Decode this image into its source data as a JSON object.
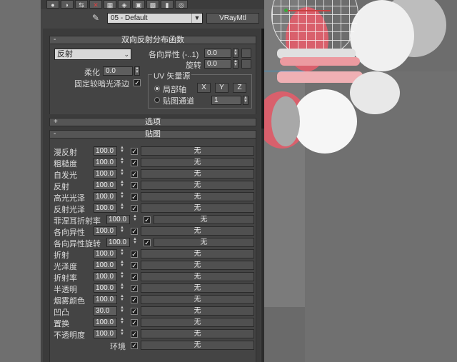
{
  "material": {
    "name": "05 - Default",
    "type": "VRayMtl"
  },
  "brdf": {
    "title": "双向反射分布函数",
    "type_value": "反射",
    "anisotropy_label": "各向异性 (-..1)",
    "anisotropy_value": "0.0",
    "rotation_label": "旋转",
    "rotation_value": "0.0",
    "soften_label": "柔化",
    "soften_value": "0.0",
    "fix_dark_edges_label": "固定较暗光泽边",
    "uv_group_label": "UV 矢量源",
    "local_axis_label": "局部轴",
    "x_label": "X",
    "y_label": "Y",
    "z_label": "Z",
    "map_channel_label": "贴图通道",
    "map_channel_value": "1"
  },
  "options": {
    "title": "选项"
  },
  "maps": {
    "title": "贴图",
    "none_label": "无",
    "rows": [
      {
        "name": "漫反射",
        "amount": "100.0"
      },
      {
        "name": "粗糙度",
        "amount": "100.0"
      },
      {
        "name": "自发光",
        "amount": "100.0"
      },
      {
        "name": "反射",
        "amount": "100.0"
      },
      {
        "name": "高光光泽",
        "amount": "100.0"
      },
      {
        "name": "反射光泽",
        "amount": "100.0"
      },
      {
        "name": "菲涅耳折射率",
        "amount": "100.0"
      },
      {
        "name": "各向异性",
        "amount": "100.0"
      },
      {
        "name": "各向异性旋转",
        "amount": "100.0"
      },
      {
        "name": "折射",
        "amount": "100.0"
      },
      {
        "name": "光泽度",
        "amount": "100.0"
      },
      {
        "name": "折射率",
        "amount": "100.0"
      },
      {
        "name": "半透明",
        "amount": "100.0"
      },
      {
        "name": "烟雾颜色",
        "amount": "100.0"
      },
      {
        "name": "凹凸",
        "amount": "30.0"
      },
      {
        "name": "置换",
        "amount": "100.0"
      },
      {
        "name": "不透明度",
        "amount": "100.0"
      },
      {
        "name": "环境",
        "amount": ""
      }
    ]
  },
  "colors": {
    "panel_bg": "#444444",
    "viewport_bg": "#6f6f6f",
    "sphere_pink": "#d9606c",
    "sphere_white": "#f2f2f2"
  },
  "icons": [
    "sphere-icon",
    "cylinder-icon",
    "assign-icon",
    "delete-icon",
    "checker-icon",
    "map-icon",
    "eyedropper-icon",
    "dropdown-icon"
  ]
}
